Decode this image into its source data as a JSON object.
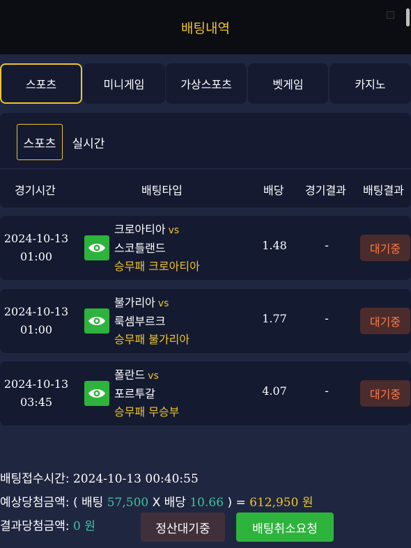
{
  "header": {
    "title": "배팅내역"
  },
  "tabs": [
    "스포츠",
    "미니게임",
    "가상스포츠",
    "벳게임",
    "카지노"
  ],
  "subtabs": [
    "스포츠",
    "실시간"
  ],
  "columns": {
    "time": "경기시간",
    "type": "배팅타입",
    "odds": "배당",
    "match_result": "경기결과",
    "bet_result": "배팅결과"
  },
  "bets": [
    {
      "date": "2024-10-13",
      "time": "01:00",
      "home": "크로아티아",
      "vs": "vs",
      "away": "스코틀랜드",
      "pick": "승무패 크로아티아",
      "odds": "1.48",
      "result": "-",
      "status": "대기중"
    },
    {
      "date": "2024-10-13",
      "time": "01:00",
      "home": "불가리아",
      "vs": "vs",
      "away": "룩셈부르크",
      "pick": "승무패 불가리아",
      "odds": "1.77",
      "result": "-",
      "status": "대기중"
    },
    {
      "date": "2024-10-13",
      "time": "03:45",
      "home": "폴란드",
      "vs": "vs",
      "away": "포르투갈",
      "pick": "승무패 무승부",
      "odds": "4.07",
      "result": "-",
      "status": "대기중"
    }
  ],
  "summary": {
    "received_label": "배팅접수시간:",
    "received_value": "2024-10-13 00:40:55",
    "expected_label": "예상당첨금액:",
    "open_paren": "( 배팅",
    "stake": "57,500",
    "times": "X 배당",
    "total_odds": "10.66",
    "close_paren": ") =",
    "payout": "612,950 원",
    "actual_label": "결과당첨금액:",
    "actual_value": "0 원"
  },
  "buttons": {
    "pending": "정산대기중",
    "cancel": "배팅취소요청"
  },
  "colors": {
    "accent": "#f0c52a",
    "background": "#1f2640",
    "panel": "#151a30",
    "green": "#2eb33c",
    "status": "#ff7a4a",
    "teal": "#3dc4a0"
  }
}
